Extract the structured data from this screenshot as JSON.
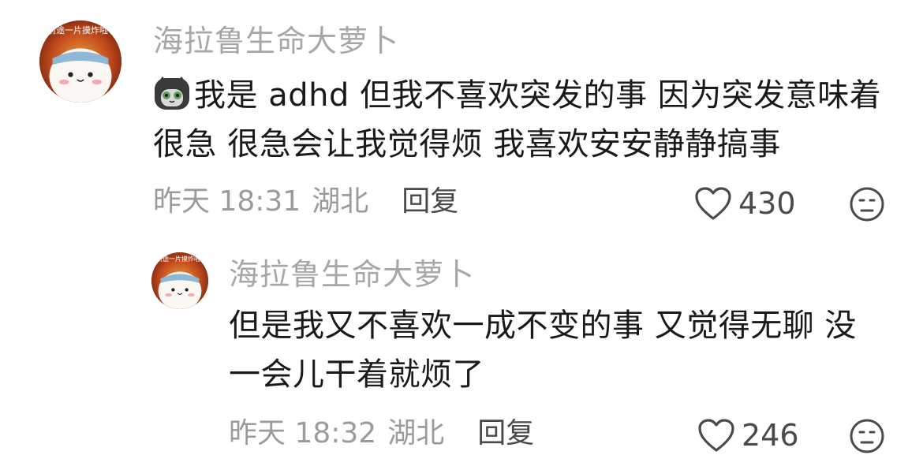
{
  "comments": [
    {
      "username": "海拉鲁生命大萝卜",
      "avatar_text": "前途一片摸炸啦",
      "content_line1": "我是 adhd 但我不喜欢突发的事 因为突发意味着",
      "content_line2": "很急 很急会让我觉得烦 我喜欢安安静静搞事",
      "time": "昨天 18:31",
      "location": "湖北",
      "reply_label": "回复",
      "likes": "430",
      "leading_emoji": "cat-emoji-icon"
    },
    {
      "username": "海拉鲁生命大萝卜",
      "avatar_text": "前途一片摸炸啦",
      "content_line1": "但是我又不喜欢一成不变的事 又觉得无聊 没",
      "content_line2": "一会儿干着就烦了",
      "time": "昨天 18:32",
      "location": "湖北",
      "reply_label": "回复",
      "likes": "246"
    }
  ],
  "colors": {
    "username": "#a7a7a7",
    "meta": "#9b9b9b",
    "reply": "#4a4a4a",
    "text": "#1a1a1a"
  }
}
